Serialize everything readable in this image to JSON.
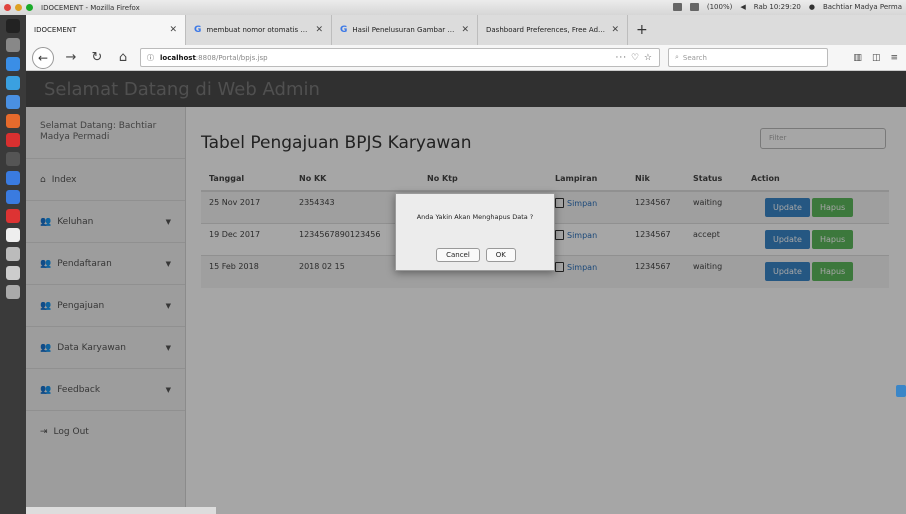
{
  "os": {
    "window_title": "IDOCEMENT - Mozilla Firefox",
    "battery": "(100%)",
    "clock": "Rab 10:29:20",
    "user": "Bachtiar Madya Perma"
  },
  "tabs": [
    {
      "label": "IDOCEMENT"
    },
    {
      "label": "membuat nomor otomatis di html"
    },
    {
      "label": "Hasil Penelusuran Gambar Googl"
    },
    {
      "label": "Dashboard Preferences, Free Admin"
    }
  ],
  "url": {
    "host": "localhost",
    "path": ":8808/Portal/bpjs.jsp",
    "search_placeholder": "Search"
  },
  "header": {
    "brand": "Selamat Datang di Web Admin"
  },
  "sidebar": {
    "welcome": "Selamat Datang: Bachtiar Madya Permadi",
    "items": [
      {
        "label": "Index",
        "icon": "home-icon"
      },
      {
        "label": "Keluhan",
        "icon": "users-icon"
      },
      {
        "label": "Pendaftaran",
        "icon": "users-icon"
      },
      {
        "label": "Pengajuan",
        "icon": "users-icon"
      },
      {
        "label": "Data Karyawan",
        "icon": "users-icon"
      },
      {
        "label": "Feedback",
        "icon": "users-icon"
      },
      {
        "label": "Log Out",
        "icon": "logout-icon"
      }
    ]
  },
  "main": {
    "title": "Tabel Pengajuan BPJS Karyawan",
    "filter_placeholder": "Filter",
    "columns": [
      "Tanggal",
      "No KK",
      "No Ktp",
      "Lampiran",
      "Nik",
      "Status",
      "Action"
    ],
    "rows": [
      {
        "tanggal": "25 Nov 2017",
        "nokk": "2354343",
        "noktp": "",
        "lampiran": "Simpan",
        "nik": "1234567",
        "status": "waiting"
      },
      {
        "tanggal": "19 Dec 2017",
        "nokk": "1234567890123456",
        "noktp": "",
        "lampiran": "Simpan",
        "nik": "1234567",
        "status": "accept"
      },
      {
        "tanggal": "15 Feb 2018",
        "nokk": "2018 02 15",
        "noktp": "",
        "lampiran": "Simpan",
        "nik": "1234567",
        "status": "waiting"
      }
    ],
    "update_label": "Update",
    "delete_label": "Hapus"
  },
  "dialog": {
    "message": "Anda Yakin Akan Menghapus Data ?",
    "cancel": "Cancel",
    "ok": "OK"
  },
  "colors": {
    "update": "#3a86c8",
    "delete": "#5cb85c",
    "link": "#2a6fba"
  }
}
